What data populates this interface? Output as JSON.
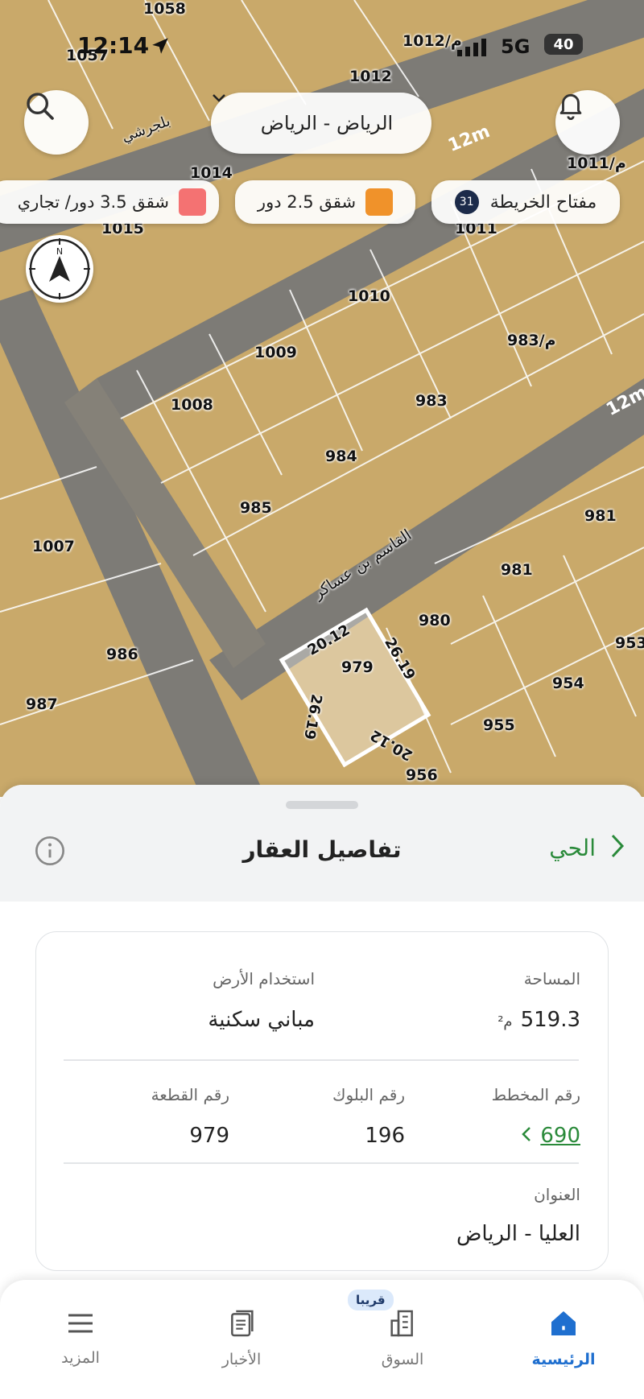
{
  "status_bar": {
    "time": "12:14",
    "network": "5G",
    "battery": "40"
  },
  "header": {
    "city_selector": "الرياض - الرياض"
  },
  "legend": {
    "map_key_label": "مفتاح الخريطة",
    "map_key_count": "31",
    "items": [
      {
        "label": "شقق 2.5 دور",
        "color": "#f0922a"
      },
      {
        "label": "شقق 3.5 دور/ تجاري",
        "color": "#f47272"
      }
    ]
  },
  "map": {
    "street_labels": [
      "القاسم بن عساكر",
      "بلجرشي",
      "12m"
    ],
    "parcel_numbers": [
      "1058",
      "1057",
      "1012",
      "1012/م",
      "1014",
      "1011/م",
      "1015",
      "1011",
      "1010",
      "1009",
      "983/م",
      "1008",
      "983",
      "984",
      "981",
      "985",
      "981",
      "1007",
      "980",
      "979",
      "986",
      "954",
      "953",
      "987",
      "955",
      "956"
    ],
    "dimensions": [
      "20.12",
      "26.19",
      "26.19",
      "20.12"
    ],
    "colors": {
      "land": "#c9a96a",
      "road": "#7d7b76",
      "parcel_line": "#ffffff",
      "selected": "#ffffff"
    }
  },
  "sheet": {
    "back_label": "الحي",
    "title": "تفاصيل العقار",
    "area": {
      "label": "المساحة",
      "value": "519.3",
      "unit": "م²"
    },
    "land_use": {
      "label": "استخدام الأرض",
      "value": "مباني سكنية"
    },
    "plan_number": {
      "label": "رقم المخطط",
      "value": "690"
    },
    "block_number": {
      "label": "رقم البلوك",
      "value": "196"
    },
    "plot_number": {
      "label": "رقم القطعة",
      "value": "979"
    },
    "address": {
      "label": "العنوان",
      "value": "العليا - الرياض"
    }
  },
  "tabbar": {
    "home": "الرئيسية",
    "market": "السوق",
    "market_badge": "قريبا",
    "news": "الأخبار",
    "more": "المزيد",
    "active_color": "#1f6fcf"
  }
}
